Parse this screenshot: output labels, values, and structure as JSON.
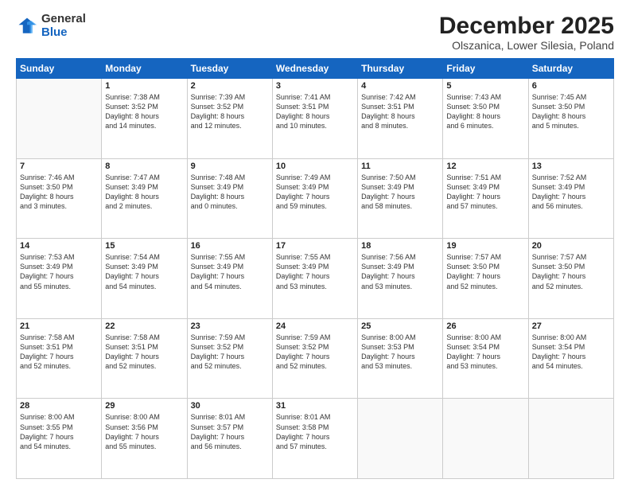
{
  "logo": {
    "general": "General",
    "blue": "Blue"
  },
  "header": {
    "month_year": "December 2025",
    "location": "Olszanica, Lower Silesia, Poland"
  },
  "weekdays": [
    "Sunday",
    "Monday",
    "Tuesday",
    "Wednesday",
    "Thursday",
    "Friday",
    "Saturday"
  ],
  "weeks": [
    [
      {
        "day": "",
        "info": ""
      },
      {
        "day": "1",
        "info": "Sunrise: 7:38 AM\nSunset: 3:52 PM\nDaylight: 8 hours\nand 14 minutes."
      },
      {
        "day": "2",
        "info": "Sunrise: 7:39 AM\nSunset: 3:52 PM\nDaylight: 8 hours\nand 12 minutes."
      },
      {
        "day": "3",
        "info": "Sunrise: 7:41 AM\nSunset: 3:51 PM\nDaylight: 8 hours\nand 10 minutes."
      },
      {
        "day": "4",
        "info": "Sunrise: 7:42 AM\nSunset: 3:51 PM\nDaylight: 8 hours\nand 8 minutes."
      },
      {
        "day": "5",
        "info": "Sunrise: 7:43 AM\nSunset: 3:50 PM\nDaylight: 8 hours\nand 6 minutes."
      },
      {
        "day": "6",
        "info": "Sunrise: 7:45 AM\nSunset: 3:50 PM\nDaylight: 8 hours\nand 5 minutes."
      }
    ],
    [
      {
        "day": "7",
        "info": "Sunrise: 7:46 AM\nSunset: 3:50 PM\nDaylight: 8 hours\nand 3 minutes."
      },
      {
        "day": "8",
        "info": "Sunrise: 7:47 AM\nSunset: 3:49 PM\nDaylight: 8 hours\nand 2 minutes."
      },
      {
        "day": "9",
        "info": "Sunrise: 7:48 AM\nSunset: 3:49 PM\nDaylight: 8 hours\nand 0 minutes."
      },
      {
        "day": "10",
        "info": "Sunrise: 7:49 AM\nSunset: 3:49 PM\nDaylight: 7 hours\nand 59 minutes."
      },
      {
        "day": "11",
        "info": "Sunrise: 7:50 AM\nSunset: 3:49 PM\nDaylight: 7 hours\nand 58 minutes."
      },
      {
        "day": "12",
        "info": "Sunrise: 7:51 AM\nSunset: 3:49 PM\nDaylight: 7 hours\nand 57 minutes."
      },
      {
        "day": "13",
        "info": "Sunrise: 7:52 AM\nSunset: 3:49 PM\nDaylight: 7 hours\nand 56 minutes."
      }
    ],
    [
      {
        "day": "14",
        "info": "Sunrise: 7:53 AM\nSunset: 3:49 PM\nDaylight: 7 hours\nand 55 minutes."
      },
      {
        "day": "15",
        "info": "Sunrise: 7:54 AM\nSunset: 3:49 PM\nDaylight: 7 hours\nand 54 minutes."
      },
      {
        "day": "16",
        "info": "Sunrise: 7:55 AM\nSunset: 3:49 PM\nDaylight: 7 hours\nand 54 minutes."
      },
      {
        "day": "17",
        "info": "Sunrise: 7:55 AM\nSunset: 3:49 PM\nDaylight: 7 hours\nand 53 minutes."
      },
      {
        "day": "18",
        "info": "Sunrise: 7:56 AM\nSunset: 3:49 PM\nDaylight: 7 hours\nand 53 minutes."
      },
      {
        "day": "19",
        "info": "Sunrise: 7:57 AM\nSunset: 3:50 PM\nDaylight: 7 hours\nand 52 minutes."
      },
      {
        "day": "20",
        "info": "Sunrise: 7:57 AM\nSunset: 3:50 PM\nDaylight: 7 hours\nand 52 minutes."
      }
    ],
    [
      {
        "day": "21",
        "info": "Sunrise: 7:58 AM\nSunset: 3:51 PM\nDaylight: 7 hours\nand 52 minutes."
      },
      {
        "day": "22",
        "info": "Sunrise: 7:58 AM\nSunset: 3:51 PM\nDaylight: 7 hours\nand 52 minutes."
      },
      {
        "day": "23",
        "info": "Sunrise: 7:59 AM\nSunset: 3:52 PM\nDaylight: 7 hours\nand 52 minutes."
      },
      {
        "day": "24",
        "info": "Sunrise: 7:59 AM\nSunset: 3:52 PM\nDaylight: 7 hours\nand 52 minutes."
      },
      {
        "day": "25",
        "info": "Sunrise: 8:00 AM\nSunset: 3:53 PM\nDaylight: 7 hours\nand 53 minutes."
      },
      {
        "day": "26",
        "info": "Sunrise: 8:00 AM\nSunset: 3:54 PM\nDaylight: 7 hours\nand 53 minutes."
      },
      {
        "day": "27",
        "info": "Sunrise: 8:00 AM\nSunset: 3:54 PM\nDaylight: 7 hours\nand 54 minutes."
      }
    ],
    [
      {
        "day": "28",
        "info": "Sunrise: 8:00 AM\nSunset: 3:55 PM\nDaylight: 7 hours\nand 54 minutes."
      },
      {
        "day": "29",
        "info": "Sunrise: 8:00 AM\nSunset: 3:56 PM\nDaylight: 7 hours\nand 55 minutes."
      },
      {
        "day": "30",
        "info": "Sunrise: 8:01 AM\nSunset: 3:57 PM\nDaylight: 7 hours\nand 56 minutes."
      },
      {
        "day": "31",
        "info": "Sunrise: 8:01 AM\nSunset: 3:58 PM\nDaylight: 7 hours\nand 57 minutes."
      },
      {
        "day": "",
        "info": ""
      },
      {
        "day": "",
        "info": ""
      },
      {
        "day": "",
        "info": ""
      }
    ]
  ]
}
